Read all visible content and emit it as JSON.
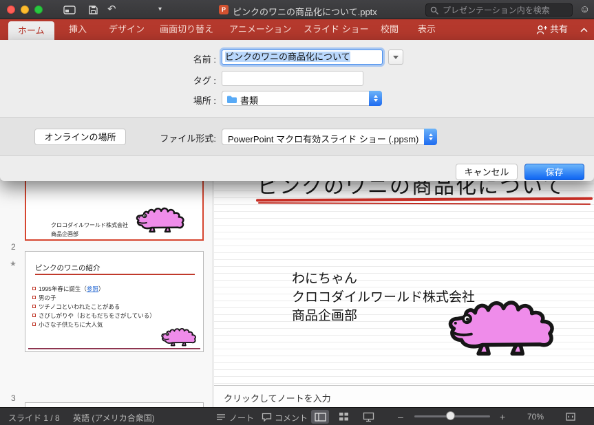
{
  "colors": {
    "ribbon_red": "#b5392d",
    "selected_tab_text": "#b8362a",
    "selection_red": "#d6452f",
    "save_blue": "#0d64f2",
    "link_blue": "#2b6cd4",
    "croc_pink": "#ef8cea",
    "underline_red": "#cf2f26"
  },
  "titlebar": {
    "title": "ピンクのワニの商品化について.pptx",
    "search_placeholder": "プレゼンテーション内を検索"
  },
  "ribbon": {
    "tabs": [
      {
        "label": "ホーム"
      },
      {
        "label": "挿入"
      },
      {
        "label": "デザイン"
      },
      {
        "label": "画面切り替え"
      },
      {
        "label": "アニメーション"
      },
      {
        "label": "スライド ショー"
      },
      {
        "label": "校閲"
      },
      {
        "label": "表示"
      }
    ],
    "share_label": "共有"
  },
  "dialog": {
    "name_label": "名前 :",
    "name_value": "ピンクのワニの商品化について",
    "tags_label": "タグ :",
    "tags_value": "",
    "where_label": "場所 :",
    "where_value": "書類",
    "online_button": "オンラインの場所",
    "format_label": "ファイル形式:",
    "format_value": "PowerPoint マクロ有効スライド ショー (.ppsm)",
    "cancel_label": "キャンセル",
    "save_label": "保存"
  },
  "glyphs": {
    "caret_down": "▾",
    "undo": "↶",
    "smiley": "☺",
    "star": "★",
    "minus": "–",
    "plus": "+"
  },
  "thumbnails": {
    "slide1": {
      "line1": "クロコダイルワールド株式会社",
      "line2": "商品企画部"
    },
    "slide2": {
      "number": "2",
      "title": "ピンクのワニの紹介",
      "bullets": [
        {
          "prefix": "1995年春に誕生（",
          "link": "参照",
          "suffix": "）"
        },
        {
          "text": "男の子"
        },
        {
          "text": "ツチノコといわれたことがある"
        },
        {
          "text": "さびしがりや（おともだちをさがしている）"
        },
        {
          "text": "小さな子供たちに大人気"
        }
      ]
    },
    "slide3": {
      "number": "3"
    }
  },
  "slide": {
    "title": "ピンクのワニの商品化について",
    "body": [
      "わにちゃん",
      "クロコダイルワールド株式会社",
      "商品企画部"
    ]
  },
  "notes": {
    "placeholder": "クリックしてノートを入力"
  },
  "statusbar": {
    "slide_indicator": "スライド 1 / 8",
    "language": "英語 (アメリカ合衆国)",
    "notes_label": "ノート",
    "comments_label": "コメント",
    "zoom_percent": "70%"
  }
}
